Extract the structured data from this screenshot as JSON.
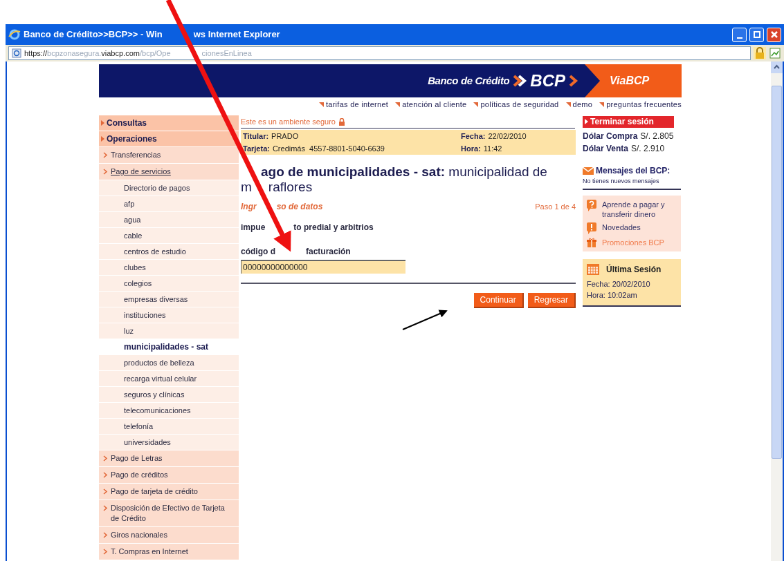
{
  "window": {
    "title": [
      "Banco de Crédito>>BCP>> - Win",
      "ws Internet Explorer"
    ],
    "address": [
      {
        "text": "https://",
        "strong": true
      },
      {
        "text": "bcpzonasegura.",
        "strong": false
      },
      {
        "text": "viabcp.com",
        "strong": true
      },
      {
        "text": "/bcp/Ope",
        "strong": false
      },
      {
        "text": "cionesEnLinea",
        "strong": false
      }
    ]
  },
  "header": {
    "bank": "Banco de Crédito",
    "brand": "BCP",
    "product": "ViaBCP"
  },
  "top_links": [
    "tarifas de internet",
    "atención al cliente",
    "políticas de seguridad",
    "demo",
    "preguntas frecuentes"
  ],
  "secure_note": "Este es un ambiente seguro",
  "logout": "Terminar sesión",
  "info": [
    {
      "label": "Titular:",
      "value": "PRADO",
      "label2": "Fecha:",
      "value2": "22/02/2010",
      "label3": "Dólar Compra",
      "value3": "S/. 2.805"
    },
    {
      "label": "Tarjeta:",
      "value": "Credimás  4557-8801-5040-6639",
      "label2": "Hora:",
      "value2": "11:42",
      "label3": "Dólar Venta",
      "value3": "S/. 2.910"
    }
  ],
  "sidebar": {
    "items": [
      {
        "label": "Consultas",
        "selected": false
      },
      {
        "label": "Operaciones",
        "selected": false,
        "children": [
          {
            "label": "Transferencias",
            "selected": false
          },
          {
            "label": "Pago de servicios",
            "selected": true,
            "children": [
              {
                "label": "Directorio de pagos",
                "selected": false
              },
              {
                "label": "afp",
                "selected": false
              },
              {
                "label": "agua",
                "selected": false
              },
              {
                "label": "cable",
                "selected": false
              },
              {
                "label": "centros de estudio",
                "selected": false
              },
              {
                "label": "clubes",
                "selected": false
              },
              {
                "label": "colegios",
                "selected": false
              },
              {
                "label": "empresas diversas",
                "selected": false
              },
              {
                "label": "instituciones",
                "selected": false
              },
              {
                "label": "luz",
                "selected": false
              },
              {
                "label": "municipalidades - sat",
                "selected": true
              },
              {
                "label": "productos de belleza",
                "selected": false
              },
              {
                "label": "recarga virtual celular",
                "selected": false
              },
              {
                "label": "seguros y clínicas",
                "selected": false
              },
              {
                "label": "telecomunicaciones",
                "selected": false
              },
              {
                "label": "telefonía",
                "selected": false
              },
              {
                "label": "universidades",
                "selected": false
              }
            ]
          },
          {
            "label": "Pago de Letras",
            "selected": false
          },
          {
            "label": "Pago de créditos",
            "selected": false
          },
          {
            "label": "Pago de tarjeta de crédito",
            "selected": false
          },
          {
            "label": "Disposición de Efectivo de Tarjeta de Crédito",
            "selected": false
          },
          {
            "label": "Giros nacionales",
            "selected": false
          },
          {
            "label": "T. Compras en Internet",
            "selected": false
          }
        ]
      }
    ]
  },
  "main": {
    "title_lines": [
      [
        "**ago de municipalidades - sat:** municipalidad de"
      ],
      [
        "m",
        "raflores"
      ]
    ],
    "section": [
      "Ingr",
      "so de datos"
    ],
    "step": "Paso 1 de 4",
    "service": [
      "impue",
      "to predial y arbitrios"
    ],
    "field": {
      "label": [
        "código d",
        "facturación"
      ],
      "value": "00000000000000"
    },
    "buttons": [
      "Continuar",
      "Regresar"
    ]
  },
  "messages": {
    "title": "Mensajes del BCP:",
    "subtitle": "No tienes nuevos mensajes"
  },
  "links": [
    {
      "kind": "question",
      "label": "Aprende a pagar y transferir dinero",
      "color": "#333366"
    },
    {
      "kind": "alert",
      "label": "Novedades",
      "color": "#333366"
    },
    {
      "kind": "gift",
      "label": "Promociones BCP",
      "color": "#f07a4a"
    }
  ],
  "last_session": {
    "title": "Última Sesión",
    "date": "Fecha: 20/02/2010",
    "time": "Hora: 10:02am"
  }
}
